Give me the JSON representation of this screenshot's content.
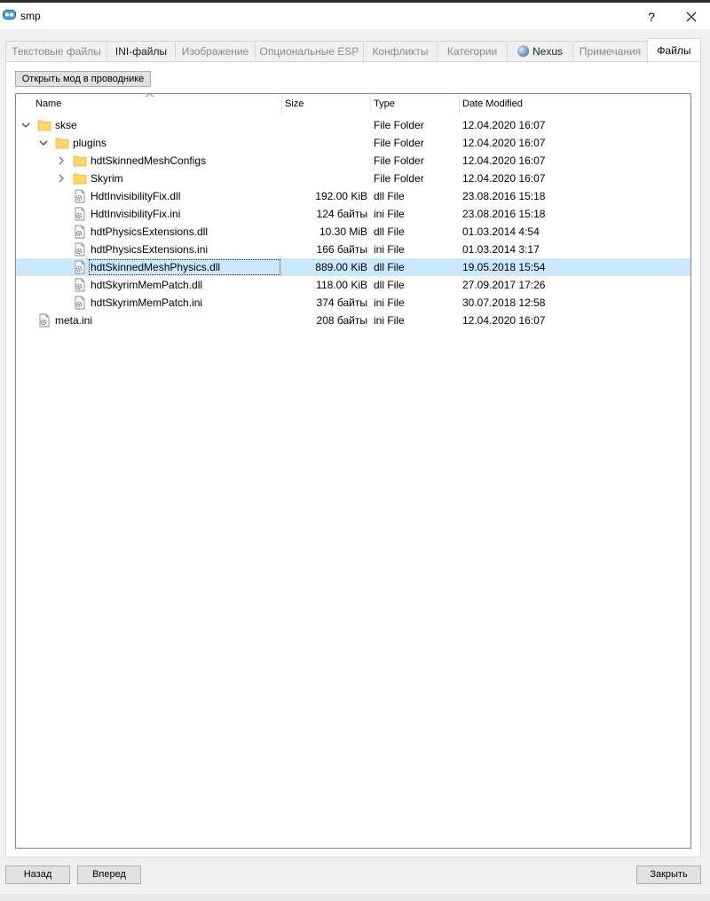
{
  "window": {
    "title": "smp",
    "help": "?"
  },
  "tabs": [
    {
      "label": "Текстовые файлы"
    },
    {
      "label": "INI-файлы"
    },
    {
      "label": "Изображение"
    },
    {
      "label": "Опциональные ESP"
    },
    {
      "label": "Конфликты"
    },
    {
      "label": "Категории"
    },
    {
      "label": "Nexus",
      "icon": "globe-icon"
    },
    {
      "label": "Примечания"
    },
    {
      "label": "Файлы"
    }
  ],
  "toolbar": {
    "open_in_explorer": "Открыть мод в проводнике"
  },
  "columns": {
    "name": "Name",
    "size": "Size",
    "type": "Type",
    "date": "Date Modified"
  },
  "rows": [
    {
      "name": "skse",
      "size": "",
      "type": "File Folder",
      "date": "12.04.2020 16:07",
      "kind": "folder",
      "expanded": true
    },
    {
      "name": "plugins",
      "size": "",
      "type": "File Folder",
      "date": "12.04.2020 16:07",
      "kind": "folder",
      "expanded": true
    },
    {
      "name": "hdtSkinnedMeshConfigs",
      "size": "",
      "type": "File Folder",
      "date": "12.04.2020 16:07",
      "kind": "folder",
      "expanded": false
    },
    {
      "name": "Skyrim",
      "size": "",
      "type": "File Folder",
      "date": "12.04.2020 16:07",
      "kind": "folder",
      "expanded": false
    },
    {
      "name": "HdtInvisibilityFix.dll",
      "size": "192.00 KiB",
      "type": "dll File",
      "date": "23.08.2016 15:18",
      "kind": "file"
    },
    {
      "name": "HdtInvisibilityFix.ini",
      "size": "124 байты",
      "type": "ini File",
      "date": "23.08.2016 15:18",
      "kind": "file"
    },
    {
      "name": "hdtPhysicsExtensions.dll",
      "size": "10.30 MiB",
      "type": "dll File",
      "date": "01.03.2014 4:54",
      "kind": "file"
    },
    {
      "name": "hdtPhysicsExtensions.ini",
      "size": "166 байты",
      "type": "ini File",
      "date": "01.03.2014 3:17",
      "kind": "file"
    },
    {
      "name": "hdtSkinnedMeshPhysics.dll",
      "size": "889.00 KiB",
      "type": "dll File",
      "date": "19.05.2018 15:54",
      "kind": "file",
      "selected": true
    },
    {
      "name": "hdtSkyrimMemPatch.dll",
      "size": "118.00 KiB",
      "type": "dll File",
      "date": "27.09.2017 17:26",
      "kind": "file"
    },
    {
      "name": "hdtSkyrimMemPatch.ini",
      "size": "374 байты",
      "type": "ini File",
      "date": "30.07.2018 12:58",
      "kind": "file"
    },
    {
      "name": "meta.ini",
      "size": "208 байты",
      "type": "ini File",
      "date": "12.04.2020 16:07",
      "kind": "file"
    }
  ],
  "buttons": {
    "back": "Назад",
    "forward": "Вперед",
    "close": "Закрыть"
  },
  "colors": {
    "selection": "#cce8ff",
    "folder": "#ffd766"
  }
}
